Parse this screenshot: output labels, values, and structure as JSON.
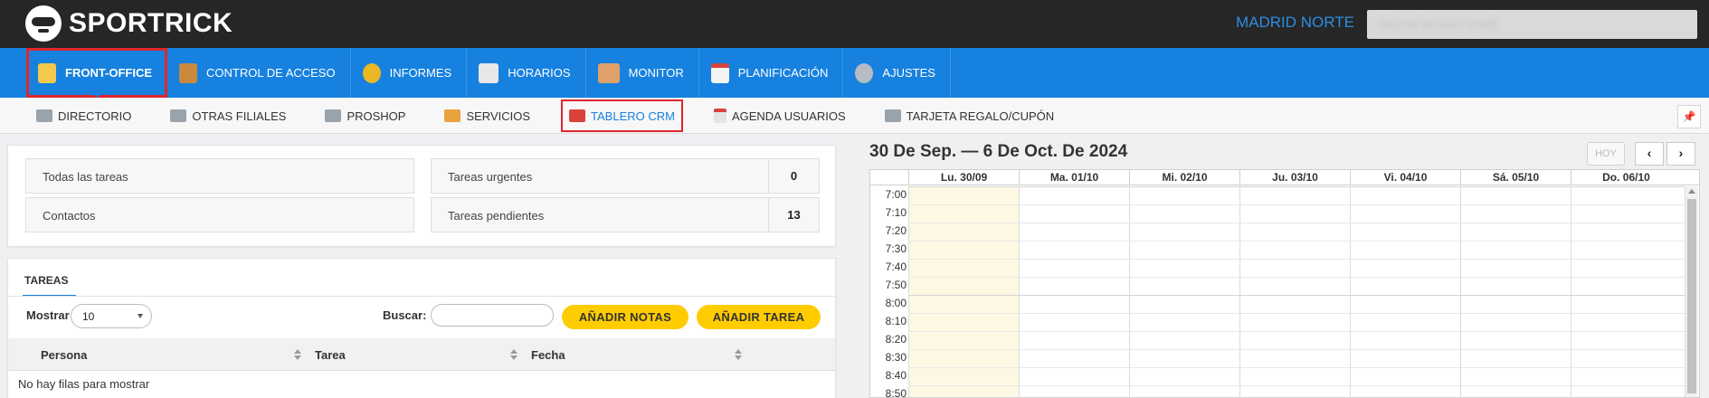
{
  "brand": {
    "logo_text": "SPORTRICK"
  },
  "header": {
    "center_name": "MADRID NORTE",
    "user_email": "(blurred account email)"
  },
  "main_nav": [
    {
      "label": "FRONT-OFFICE",
      "icon": "user-icon",
      "active": true
    },
    {
      "label": "CONTROL DE ACCESO",
      "icon": "access-control-icon"
    },
    {
      "label": "INFORMES",
      "icon": "pie-chart-icon"
    },
    {
      "label": "HORARIOS",
      "icon": "schedule-grid-icon"
    },
    {
      "label": "MONITOR",
      "icon": "people-icon"
    },
    {
      "label": "PLANIFICACIÓN",
      "icon": "calendar-icon"
    },
    {
      "label": "AJUSTES",
      "icon": "gear-icon"
    }
  ],
  "sub_nav": [
    {
      "label": "DIRECTORIO",
      "icon": "directory-icon"
    },
    {
      "label": "OTRAS FILIALES",
      "icon": "branches-icon"
    },
    {
      "label": "PROSHOP",
      "icon": "shop-icon"
    },
    {
      "label": "SERVICIOS",
      "icon": "services-icon"
    },
    {
      "label": "TABLERO CRM",
      "icon": "crm-board-icon",
      "active": true
    },
    {
      "label": "AGENDA USUARIOS",
      "icon": "agenda-icon"
    },
    {
      "label": "TARJETA REGALO/CUPÓN",
      "icon": "gift-card-icon"
    }
  ],
  "stats": {
    "todas": "Todas las tareas",
    "contactos": "Contactos",
    "urgentes": {
      "label": "Tareas urgentes",
      "value": "0"
    },
    "pendientes": {
      "label": "Tareas pendientes",
      "value": "13"
    }
  },
  "tasks": {
    "tab_label": "TAREAS",
    "show_label": "Mostrar",
    "show_value": "10",
    "search_label": "Buscar:",
    "search_value": "",
    "add_notes_button": "AÑADIR NOTAS",
    "add_task_button": "AÑADIR TAREA",
    "columns": [
      "Persona",
      "Tarea",
      "Fecha"
    ],
    "empty_text": "No hay filas para mostrar"
  },
  "calendar": {
    "title": "30 De Sep. — 6 De Oct. De 2024",
    "today_button": "HOY",
    "prev_button": "‹",
    "next_button": "›",
    "days": [
      "Lu. 30/09",
      "Ma. 01/10",
      "Mi. 02/10",
      "Ju. 03/10",
      "Vi. 04/10",
      "Sá. 05/10",
      "Do. 06/10"
    ],
    "today_index": 0,
    "times": [
      "7:00",
      "7:10",
      "7:20",
      "7:30",
      "7:40",
      "7:50",
      "8:00",
      "8:10",
      "8:20",
      "8:30",
      "8:40",
      "8:50"
    ]
  },
  "colors": {
    "primary": "#1681df",
    "topbar": "#262626",
    "accent_yellow": "#ffcc00",
    "highlight_red": "#e0262c",
    "today_bg": "#fcf8e3"
  }
}
